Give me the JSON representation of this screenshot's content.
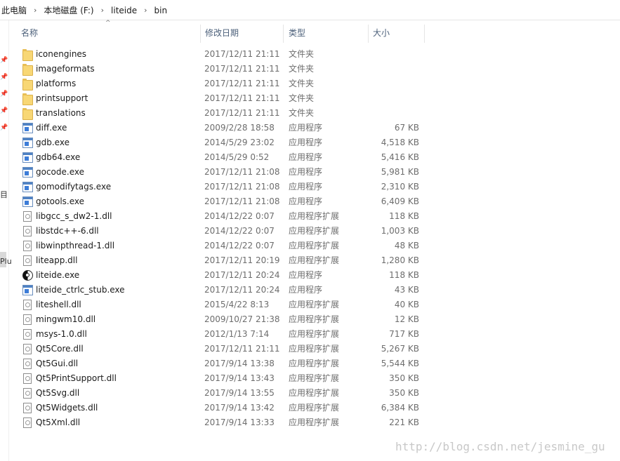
{
  "breadcrumb": [
    "此电脑",
    "本地磁盘 (F:)",
    "liteide",
    "bin"
  ],
  "breadcrumb_separator": "›",
  "columns": {
    "name": "名称",
    "date": "修改日期",
    "type": "类型",
    "size": "大小"
  },
  "sort_indicator": "^",
  "nav_fragments": {
    "a": "目",
    "b": "Plu"
  },
  "files": [
    {
      "name": "iconengines",
      "date": "2017/12/11 21:11",
      "type": "文件夹",
      "size": "",
      "icon": "folder-icon"
    },
    {
      "name": "imageformats",
      "date": "2017/12/11 21:11",
      "type": "文件夹",
      "size": "",
      "icon": "folder-icon"
    },
    {
      "name": "platforms",
      "date": "2017/12/11 21:11",
      "type": "文件夹",
      "size": "",
      "icon": "folder-icon"
    },
    {
      "name": "printsupport",
      "date": "2017/12/11 21:11",
      "type": "文件夹",
      "size": "",
      "icon": "folder-icon"
    },
    {
      "name": "translations",
      "date": "2017/12/11 21:11",
      "type": "文件夹",
      "size": "",
      "icon": "folder-icon"
    },
    {
      "name": "diff.exe",
      "date": "2009/2/28 18:58",
      "type": "应用程序",
      "size": "67 KB",
      "icon": "exe-icon"
    },
    {
      "name": "gdb.exe",
      "date": "2014/5/29 23:02",
      "type": "应用程序",
      "size": "4,518 KB",
      "icon": "exe-icon"
    },
    {
      "name": "gdb64.exe",
      "date": "2014/5/29 0:52",
      "type": "应用程序",
      "size": "5,416 KB",
      "icon": "exe-icon"
    },
    {
      "name": "gocode.exe",
      "date": "2017/12/11 21:08",
      "type": "应用程序",
      "size": "5,981 KB",
      "icon": "exe-icon"
    },
    {
      "name": "gomodifytags.exe",
      "date": "2017/12/11 21:08",
      "type": "应用程序",
      "size": "2,310 KB",
      "icon": "exe-icon"
    },
    {
      "name": "gotools.exe",
      "date": "2017/12/11 21:08",
      "type": "应用程序",
      "size": "6,409 KB",
      "icon": "exe-icon"
    },
    {
      "name": "libgcc_s_dw2-1.dll",
      "date": "2014/12/22 0:07",
      "type": "应用程序扩展",
      "size": "118 KB",
      "icon": "dll-icon"
    },
    {
      "name": "libstdc++-6.dll",
      "date": "2014/12/22 0:07",
      "type": "应用程序扩展",
      "size": "1,003 KB",
      "icon": "dll-icon"
    },
    {
      "name": "libwinpthread-1.dll",
      "date": "2014/12/22 0:07",
      "type": "应用程序扩展",
      "size": "48 KB",
      "icon": "dll-icon"
    },
    {
      "name": "liteapp.dll",
      "date": "2017/12/11 20:19",
      "type": "应用程序扩展",
      "size": "1,280 KB",
      "icon": "dll-icon"
    },
    {
      "name": "liteide.exe",
      "date": "2017/12/11 20:24",
      "type": "应用程序",
      "size": "118 KB",
      "icon": "yinyang-icon"
    },
    {
      "name": "liteide_ctrlc_stub.exe",
      "date": "2017/12/11 20:24",
      "type": "应用程序",
      "size": "43 KB",
      "icon": "exe-icon"
    },
    {
      "name": "liteshell.dll",
      "date": "2015/4/22 8:13",
      "type": "应用程序扩展",
      "size": "40 KB",
      "icon": "dll-icon"
    },
    {
      "name": "mingwm10.dll",
      "date": "2009/10/27 21:38",
      "type": "应用程序扩展",
      "size": "12 KB",
      "icon": "dll-icon"
    },
    {
      "name": "msys-1.0.dll",
      "date": "2012/1/13 7:14",
      "type": "应用程序扩展",
      "size": "717 KB",
      "icon": "dll-icon"
    },
    {
      "name": "Qt5Core.dll",
      "date": "2017/12/11 21:11",
      "type": "应用程序扩展",
      "size": "5,267 KB",
      "icon": "dll-icon"
    },
    {
      "name": "Qt5Gui.dll",
      "date": "2017/9/14 13:38",
      "type": "应用程序扩展",
      "size": "5,544 KB",
      "icon": "dll-icon"
    },
    {
      "name": "Qt5PrintSupport.dll",
      "date": "2017/9/14 13:43",
      "type": "应用程序扩展",
      "size": "350 KB",
      "icon": "dll-icon"
    },
    {
      "name": "Qt5Svg.dll",
      "date": "2017/9/14 13:55",
      "type": "应用程序扩展",
      "size": "350 KB",
      "icon": "dll-icon"
    },
    {
      "name": "Qt5Widgets.dll",
      "date": "2017/9/14 13:42",
      "type": "应用程序扩展",
      "size": "6,384 KB",
      "icon": "dll-icon"
    },
    {
      "name": "Qt5Xml.dll",
      "date": "2017/9/14 13:33",
      "type": "应用程序扩展",
      "size": "221 KB",
      "icon": "dll-icon"
    }
  ],
  "watermark": "http://blog.csdn.net/jesmine_gu",
  "colors": {
    "header_text": "#4c607a",
    "meta_text": "#6d6d6d",
    "folder": "#f8d775"
  }
}
